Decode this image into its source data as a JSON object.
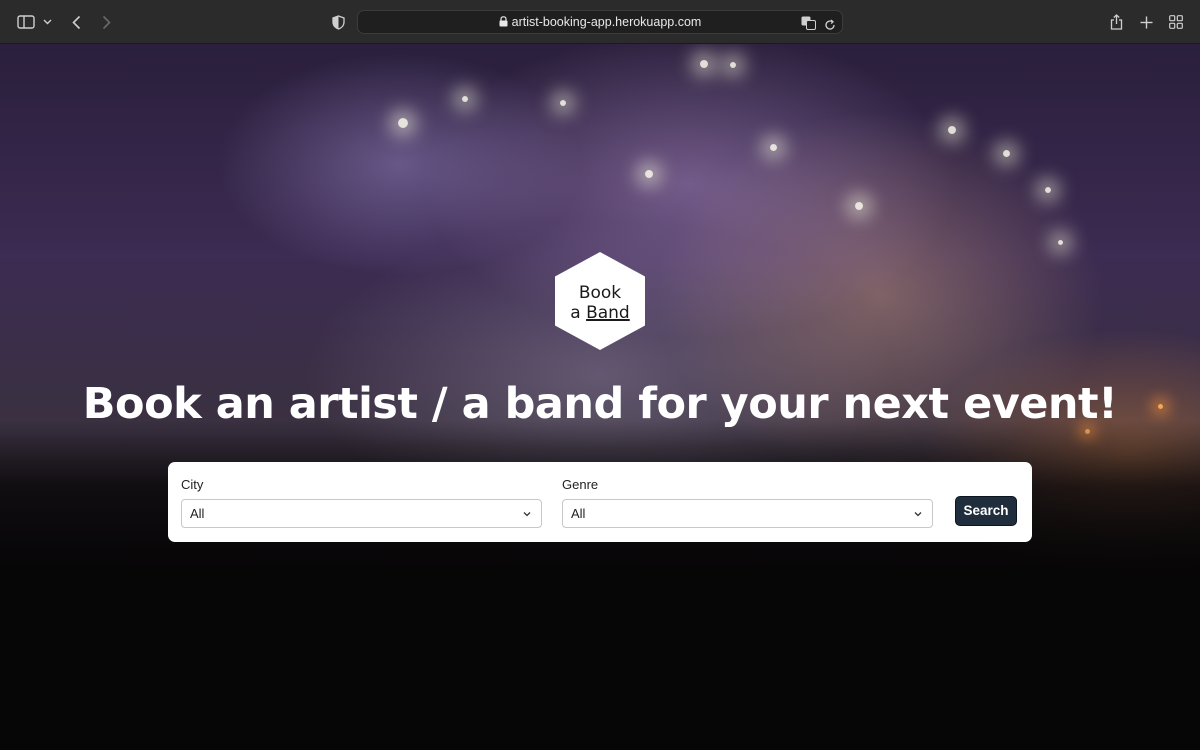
{
  "browser": {
    "url": "artist-booking-app.herokuapp.com",
    "icons": [
      "sidebar-icon",
      "chevron-down-icon",
      "back-icon",
      "forward-icon",
      "shield-icon",
      "lock-icon",
      "translate-icon",
      "reload-icon",
      "share-icon",
      "new-tab-icon",
      "tab-overview-icon"
    ]
  },
  "logo": {
    "line1": "Book",
    "line2_prefix": "a",
    "line2_underlined": "Band"
  },
  "hero": {
    "headline": "Book an artist / a band for your next event!"
  },
  "search": {
    "city_label": "City",
    "city_value": "All",
    "genre_label": "Genre",
    "genre_value": "All",
    "button_label": "Search"
  },
  "colors": {
    "button_bg": "#1f2d3d",
    "toolbar_bg": "#2b2b2b"
  }
}
